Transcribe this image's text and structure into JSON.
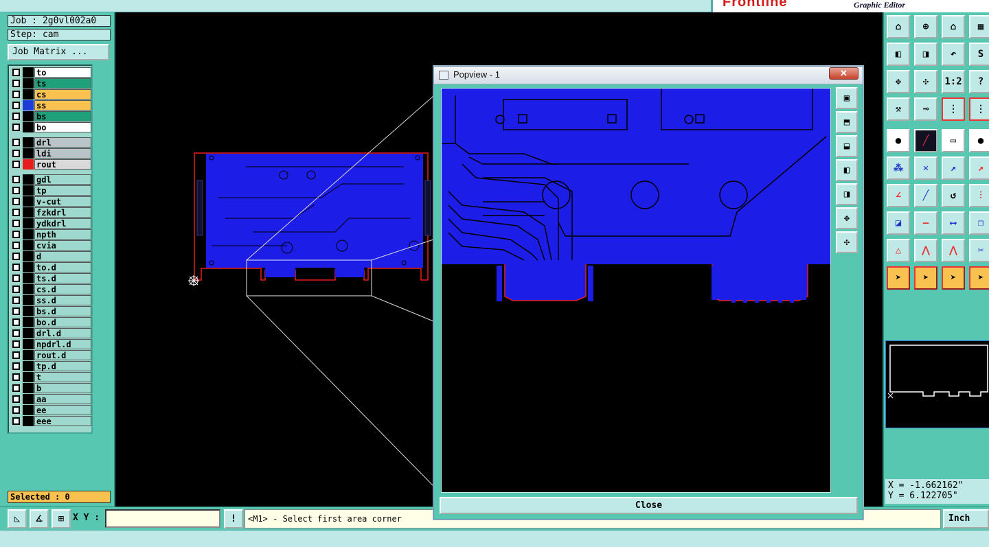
{
  "app": {
    "brand": "Frontline",
    "subtitle": "Graphic Editor"
  },
  "job": {
    "job_label": "Job : 2g0vl002a0",
    "step_label": "Step: cam",
    "matrix_button": "Job Matrix ..."
  },
  "layers": [
    {
      "name": "to",
      "bg": "#ffffff",
      "swatch": "#000000"
    },
    {
      "name": "ts",
      "bg": "#1fa07a",
      "swatch": "#000000"
    },
    {
      "name": "cs",
      "bg": "#f9c150",
      "swatch": "#000000"
    },
    {
      "name": "ss",
      "bg": "#f9c150",
      "swatch": "#1d3bd6"
    },
    {
      "name": "bs",
      "bg": "#1fa07a",
      "swatch": "#000000"
    },
    {
      "name": "bo",
      "bg": "#ffffff",
      "swatch": "#000000"
    },
    {
      "name": "drl",
      "bg": "#b9c4c9",
      "swatch": "#000000"
    },
    {
      "name": "ldi",
      "bg": "#b9c4c9",
      "swatch": "#000000"
    },
    {
      "name": "rout",
      "bg": "#d9d9d9",
      "swatch": "#e81c1c"
    },
    {
      "name": "gdl",
      "bg": "#9fd9cd",
      "swatch": "#000000"
    },
    {
      "name": "tp",
      "bg": "#9fd9cd",
      "swatch": "#000000"
    },
    {
      "name": "v-cut",
      "bg": "#9fd9cd",
      "swatch": "#000000"
    },
    {
      "name": "fzkdrl",
      "bg": "#9fd9cd",
      "swatch": "#000000"
    },
    {
      "name": "ydkdrl",
      "bg": "#9fd9cd",
      "swatch": "#000000"
    },
    {
      "name": "npth",
      "bg": "#9fd9cd",
      "swatch": "#000000"
    },
    {
      "name": "cvia",
      "bg": "#9fd9cd",
      "swatch": "#000000"
    },
    {
      "name": "d",
      "bg": "#9fd9cd",
      "swatch": "#000000"
    },
    {
      "name": "to.d",
      "bg": "#9fd9cd",
      "swatch": "#000000"
    },
    {
      "name": "ts.d",
      "bg": "#9fd9cd",
      "swatch": "#000000"
    },
    {
      "name": "cs.d",
      "bg": "#9fd9cd",
      "swatch": "#000000"
    },
    {
      "name": "ss.d",
      "bg": "#9fd9cd",
      "swatch": "#000000"
    },
    {
      "name": "bs.d",
      "bg": "#9fd9cd",
      "swatch": "#000000"
    },
    {
      "name": "bo.d",
      "bg": "#9fd9cd",
      "swatch": "#000000"
    },
    {
      "name": "drl.d",
      "bg": "#9fd9cd",
      "swatch": "#000000"
    },
    {
      "name": "npdrl.d",
      "bg": "#9fd9cd",
      "swatch": "#000000"
    },
    {
      "name": "rout.d",
      "bg": "#9fd9cd",
      "swatch": "#000000"
    },
    {
      "name": "tp.d",
      "bg": "#9fd9cd",
      "swatch": "#000000"
    },
    {
      "name": "t",
      "bg": "#9fd9cd",
      "swatch": "#000000"
    },
    {
      "name": "b",
      "bg": "#9fd9cd",
      "swatch": "#000000"
    },
    {
      "name": "aa",
      "bg": "#9fd9cd",
      "swatch": "#000000"
    },
    {
      "name": "ee",
      "bg": "#9fd9cd",
      "swatch": "#000000"
    },
    {
      "name": "eee",
      "bg": "#9fd9cd",
      "swatch": "#000000"
    }
  ],
  "selected_label": "Selected : 0",
  "popup": {
    "title": "Popview - 1",
    "close_x": "✕",
    "close_button": "Close"
  },
  "coords": {
    "x": "X = -1.662162\"",
    "y": "Y = 6.122705\""
  },
  "bottom": {
    "xy_label": "X Y :",
    "xy_value": "",
    "excl": "!",
    "message": "<M1> - Select first area corner",
    "unit": "Inch"
  },
  "tools": {
    "ratio_label": "1:2",
    "help_label": "?"
  },
  "colors": {
    "board": "#1d1de8",
    "rout": "#e81c1c",
    "accent": "#58c7b1"
  }
}
